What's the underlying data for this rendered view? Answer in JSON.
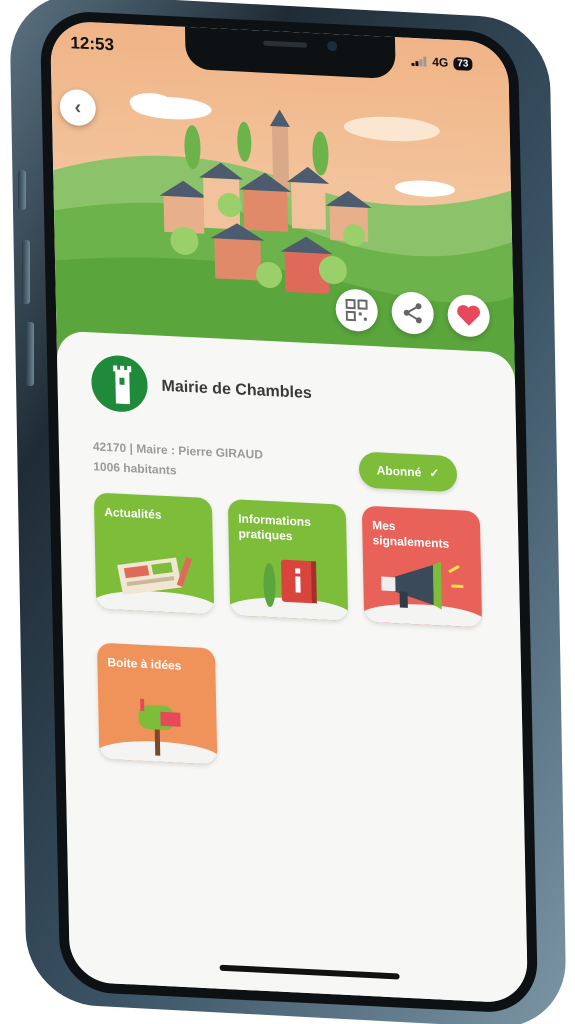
{
  "status_bar": {
    "time": "12:53",
    "network": "4G",
    "battery": "73"
  },
  "organization": {
    "name": "Mairie de Chambles",
    "meta_line1": "42170 | Maire : Pierre GIRAUD",
    "meta_line2": "1006 habitants",
    "follow_label": "Abonné",
    "follow_check": "✓"
  },
  "tiles": [
    {
      "label": "Actualités",
      "color": "#7dbd3a"
    },
    {
      "label": "Informations pratiques",
      "color": "#7dbd3a"
    },
    {
      "label": "Mes signalements",
      "color": "#e8625a"
    },
    {
      "label": "Boite à idées",
      "color": "#f0935a"
    }
  ],
  "icons": {
    "back": "chevron-left-icon",
    "qr": "qr-code-icon",
    "share": "share-icon",
    "favorite": "heart-icon"
  },
  "colors": {
    "brand_green": "#7dbd3a",
    "favorite_red": "#e8495a",
    "sky": "#f3c49a"
  }
}
